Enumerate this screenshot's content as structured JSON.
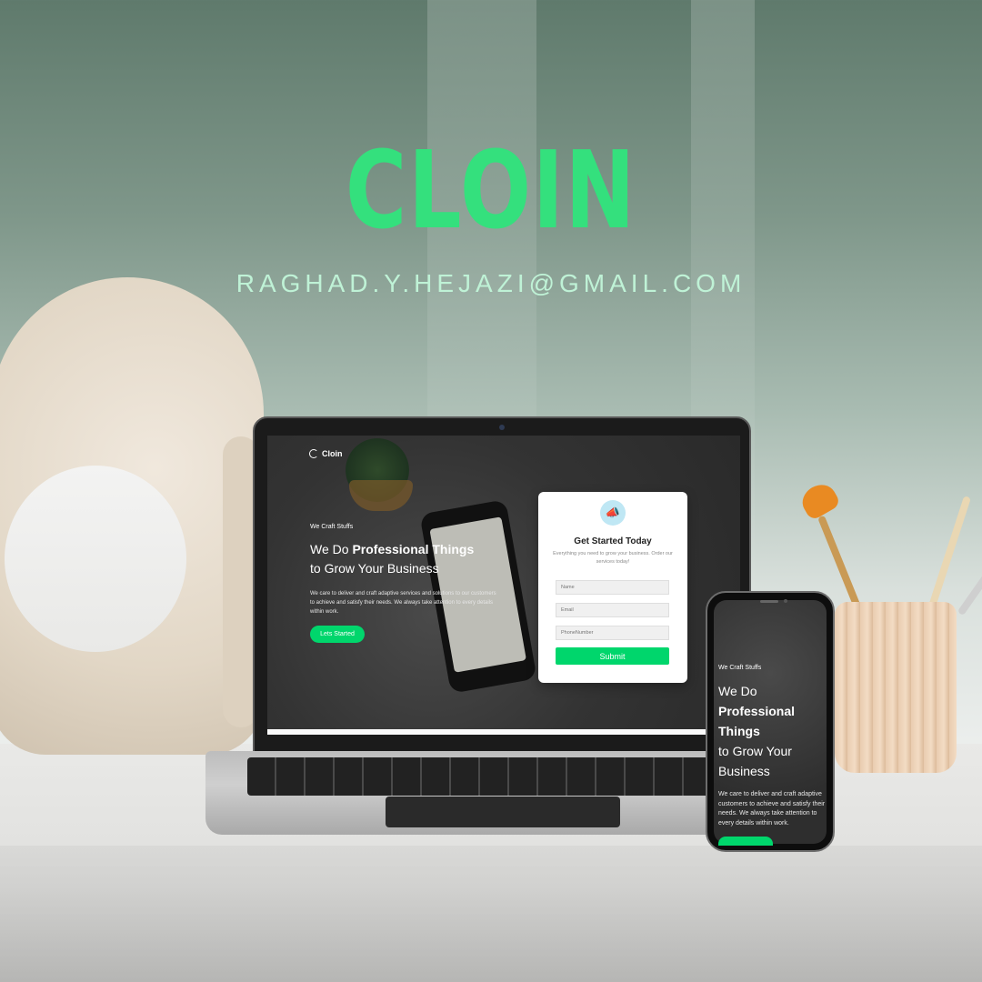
{
  "poster": {
    "headline": "CLOIN",
    "email": "RAGHAD.Y.HEJAZI@GMAIL.COM"
  },
  "colors": {
    "accent": "#34e07d",
    "button_green": "#00d66c",
    "email_text": "#bff2d6"
  },
  "laptop": {
    "brand": "Cloin",
    "tagline": "We Craft Stuffs",
    "hero_prefix": "We Do",
    "hero_bold": "Professional Things",
    "hero_suffix": "to Grow Your Business",
    "body": "We care to deliver and craft adaptive services and solutions to our customers to achieve and satisfy their needs. We always take attention to every details within work.",
    "cta_label": "Lets Started",
    "form": {
      "icon": "megaphone-icon",
      "title": "Get Started Today",
      "subtitle": "Everything you need to grow your business. Order our services today!",
      "name_placeholder": "Name",
      "email_placeholder": "Email",
      "phone_placeholder": "PhoneNumber",
      "submit_label": "Submit"
    }
  },
  "phone": {
    "tagline": "We Craft Stuffs",
    "hero_prefix": "We Do",
    "hero_bold": "Professional Things",
    "hero_suffix": "to Grow Your Business",
    "body": "We care to deliver and craft adaptive customers to achieve and satisfy their needs. We always take attention to every details within work."
  }
}
